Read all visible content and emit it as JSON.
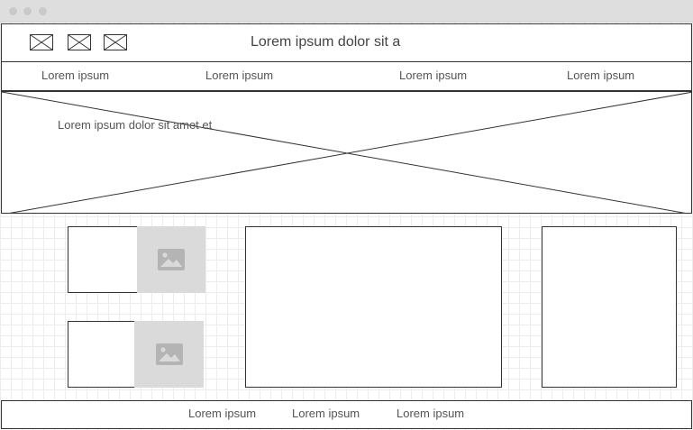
{
  "header": {
    "title": "Lorem ipsum dolor sit a",
    "icons": [
      "image-placeholder-icon",
      "image-placeholder-icon",
      "image-placeholder-icon"
    ]
  },
  "nav": {
    "items": [
      "Lorem ipsum",
      "Lorem ipsum",
      "Lorem ipsum",
      "Lorem ipsum"
    ]
  },
  "hero": {
    "text": "Lorem ipsum dolor sit amet et"
  },
  "footer": {
    "links": [
      "Lorem ipsum",
      "Lorem ipsum",
      "Lorem ipsum"
    ]
  },
  "colors": {
    "border": "#333333",
    "placeholder_fill": "#dadada",
    "placeholder_icon": "#b4b4b4",
    "titlebar": "#dedede"
  }
}
